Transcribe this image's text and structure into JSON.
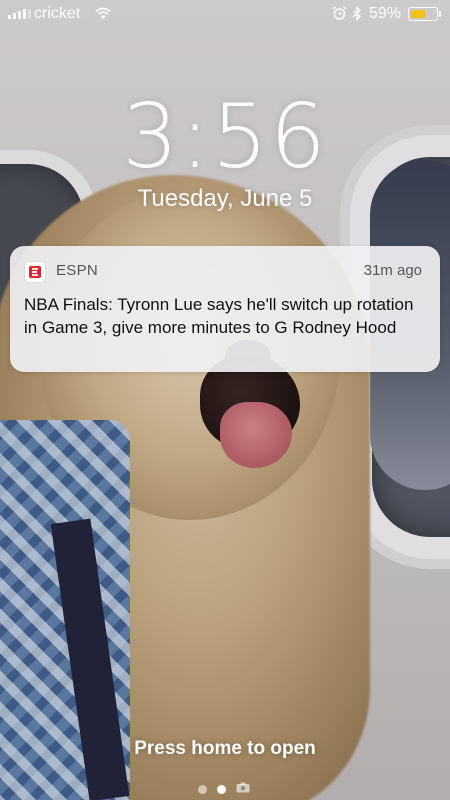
{
  "status_bar": {
    "carrier": "cricket",
    "battery_percent": "59%",
    "battery_level": 0.59,
    "signal_bars": 4,
    "icons": [
      "signal-icon",
      "wifi-icon",
      "alarm-icon",
      "bluetooth-icon",
      "battery-icon"
    ],
    "battery_color": "#f5c118"
  },
  "lock_screen": {
    "time": "3:56",
    "date": "Tuesday, June 5",
    "footer_text": "Press home to open",
    "pages": 3,
    "active_page": 1
  },
  "notification": {
    "app_name": "ESPN",
    "time_ago": "31m ago",
    "message": "NBA Finals: Tyronn Lue says he'll switch up rotation in Game 3, give more minutes to G Rodney Hood",
    "app_icon": "espn-icon",
    "app_color": "#e8232a"
  }
}
